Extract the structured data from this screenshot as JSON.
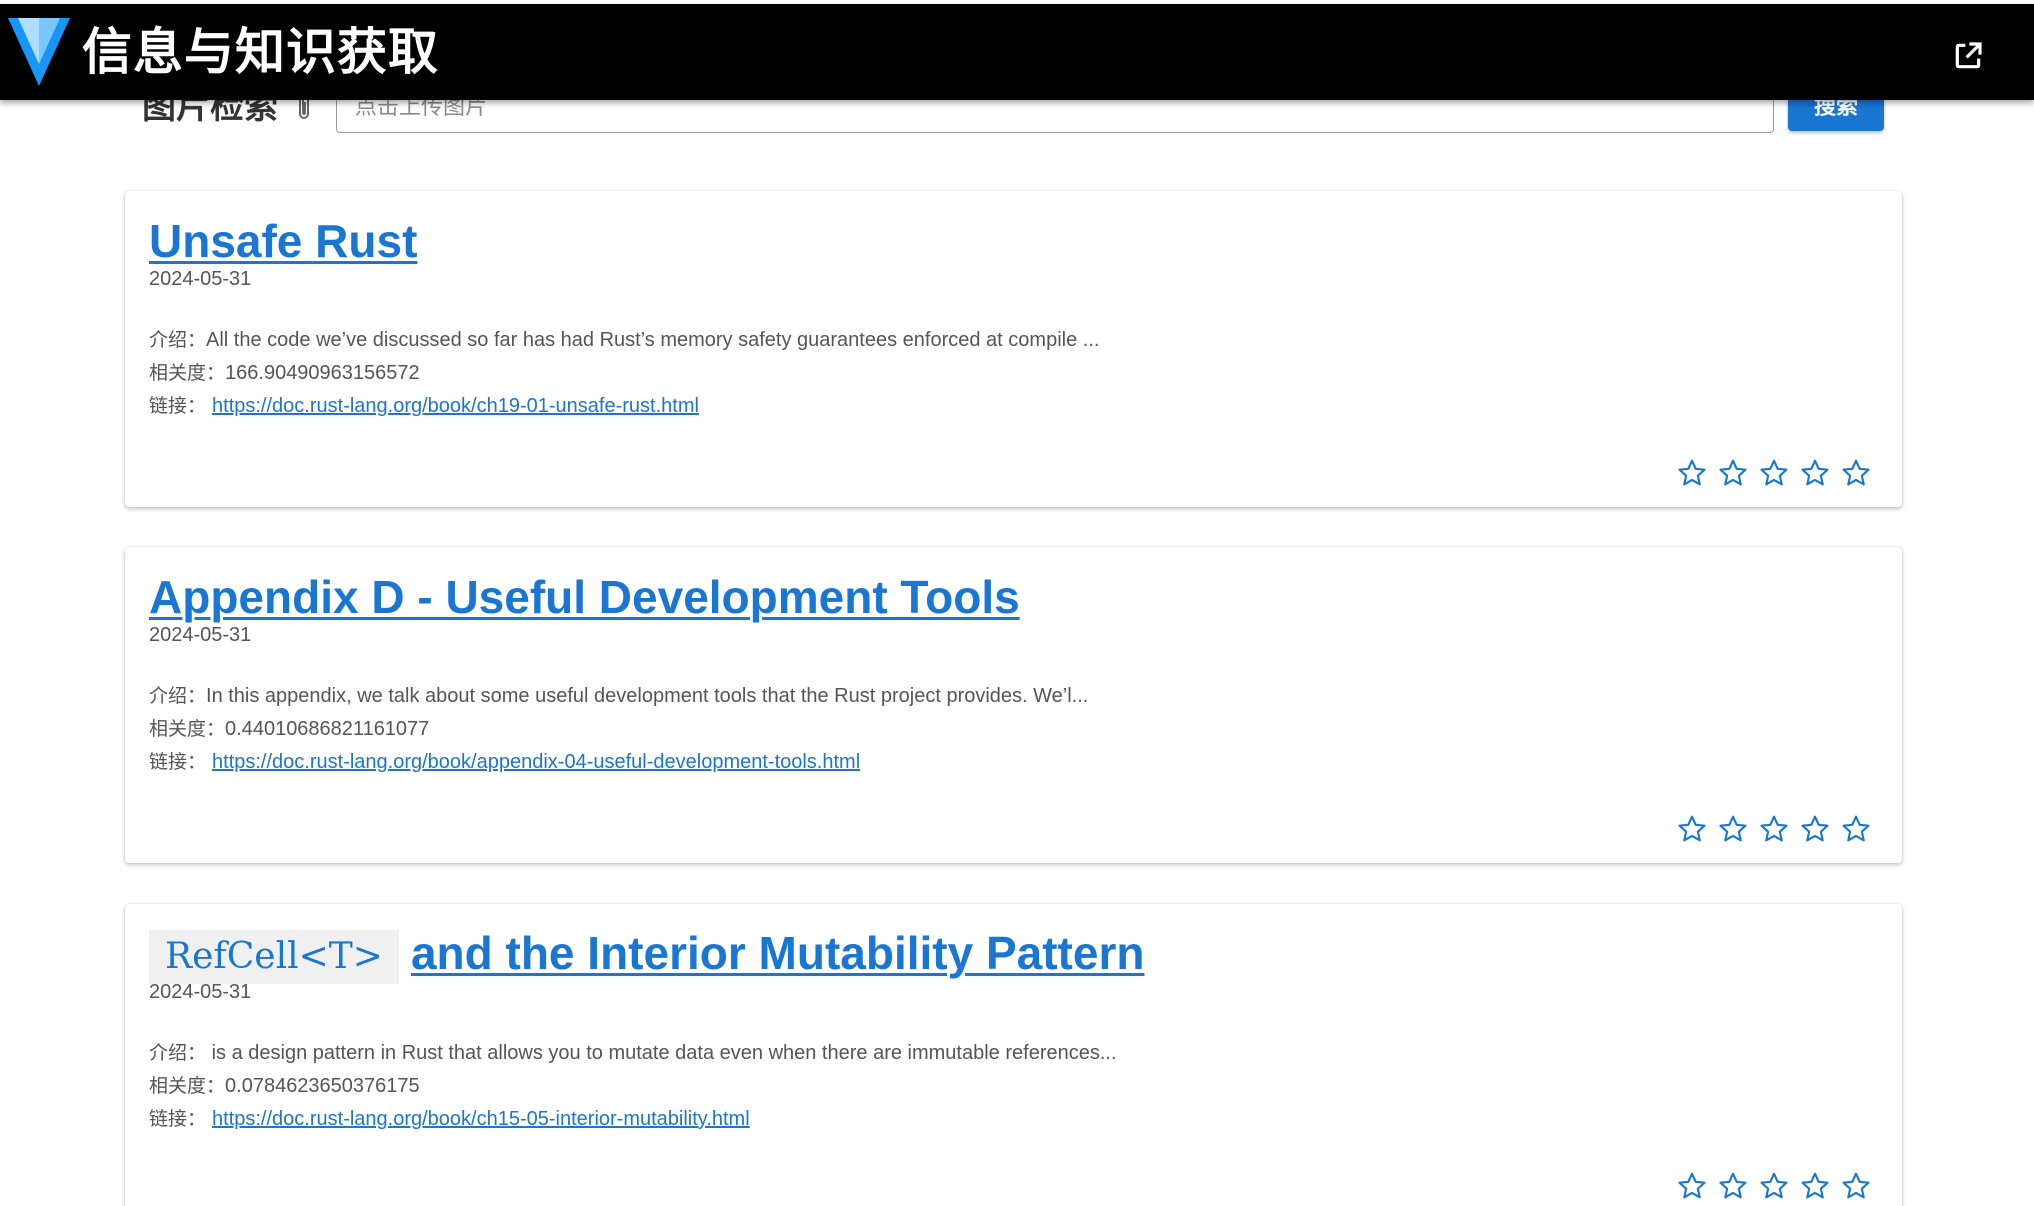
{
  "app": {
    "title": "信息与知识获取",
    "logo_icon": "vuetify-logo-icon",
    "open_icon": "open-in-new-icon"
  },
  "search": {
    "label": "图片检索",
    "placeholder": "点击上传图片",
    "button_label": "搜索",
    "attach_icon": "paperclip-icon"
  },
  "labels": {
    "intro": "介绍：",
    "relevance": "相关度：",
    "link": "链接："
  },
  "results": [
    {
      "title": "Unsafe Rust",
      "date": "2024-05-31",
      "intro": "All the code we’ve discussed so far has had Rust’s memory safety guarantees enforced at compile ...",
      "relevance": "166.90490963156572",
      "url": "https://doc.rust-lang.org/book/ch19-01-unsafe-rust.html",
      "rating": 0
    },
    {
      "title": "Appendix D - Useful Development Tools",
      "date": "2024-05-31",
      "intro": "In this appendix, we talk about some useful development tools that the Rust project provides. We’l...",
      "relevance": "0.44010686821161077",
      "url": "https://doc.rust-lang.org/book/appendix-04-useful-development-tools.html",
      "rating": 0
    },
    {
      "title_code": "RefCell<T>",
      "title": "and the Interior Mutability Pattern",
      "date": "2024-05-31",
      "intro": " is a design pattern in Rust that allows you to mutate data even when there are immutable references...",
      "relevance": "0.0784623650376175",
      "url": "https://doc.rust-lang.org/book/ch15-05-interior-mutability.html",
      "rating": 0
    }
  ],
  "star_icon": "star-outline-icon",
  "colors": {
    "appbar": "#000000",
    "primary": "#1976d2",
    "star": "#1976d2"
  }
}
